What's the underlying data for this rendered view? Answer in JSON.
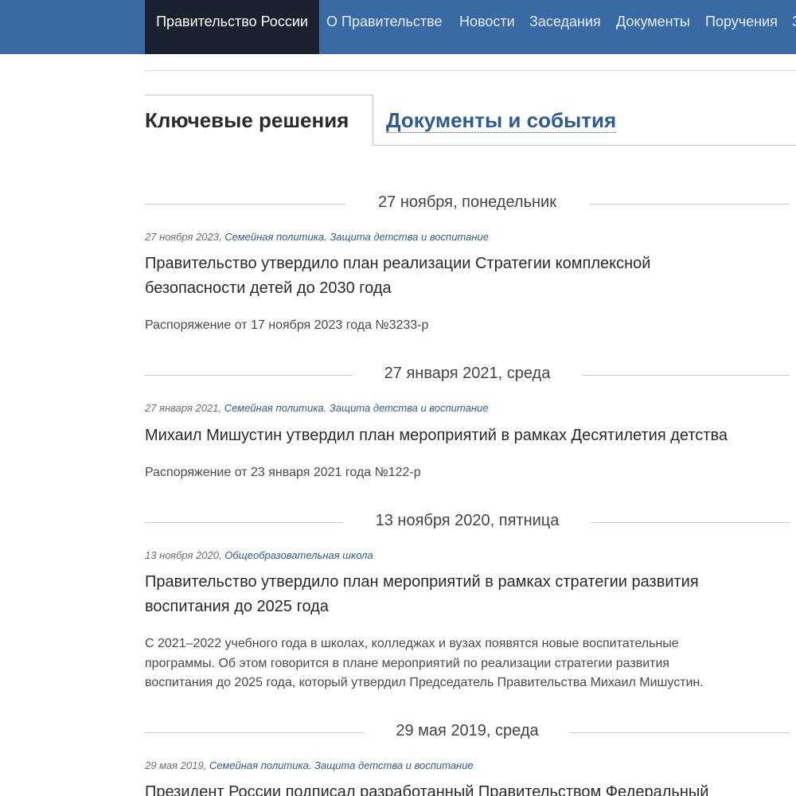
{
  "nav": {
    "home": "Правительство России",
    "items": [
      "О Правительстве",
      "Новости",
      "Заседания",
      "Документы",
      "Поручения",
      "З"
    ]
  },
  "tabs": {
    "active": "Ключевые решения",
    "other": "Документы и события"
  },
  "entries": [
    {
      "day_label": "27 ноября, понедельник",
      "meta_date": "27 ноября 2023,",
      "meta_tags": "Семейная политика. Защита детства и воспитание",
      "title_lines": [
        "Правительство утвердило план реализации Стратегии комплексной",
        "безопасности детей до 2030 года"
      ],
      "lead": "Распоряжение от 17 ноября 2023 года №3233-р"
    },
    {
      "day_label": "27 января 2021, среда",
      "meta_date": "27 января 2021,",
      "meta_tags": "Семейная политика. Защита детства и воспитание",
      "title_lines": [
        "Михаил Мишустин утвердил план мероприятий в рамках Десятилетия детства"
      ],
      "lead": "Распоряжение от 23 января 2021 года №122-р"
    },
    {
      "day_label": "13 ноября 2020, пятница",
      "meta_date": "13 ноября 2020,",
      "meta_tags": "Общеобразовательная школа",
      "title_lines": [
        "Правительство утвердило план мероприятий в рамках стратегии развития",
        "воспитания до 2025 года"
      ],
      "lead_lines": [
        "С 2021–2022 учебного года в школах, колледжах и вузах появятся новые воспитательные",
        "программы. Об этом говорится в плане мероприятий по реализации стратегии развития",
        "воспитания до 2025 года, который утвердил Председатель Правительства Михаил Мишустин."
      ]
    },
    {
      "day_label": "29 мая 2019, среда",
      "meta_date": "29 мая 2019,",
      "meta_tags": "Семейная политика. Защита детства и воспитание",
      "title_lines": [
        "Президент России подписал разработанный Правительством Федеральный"
      ]
    }
  ]
}
